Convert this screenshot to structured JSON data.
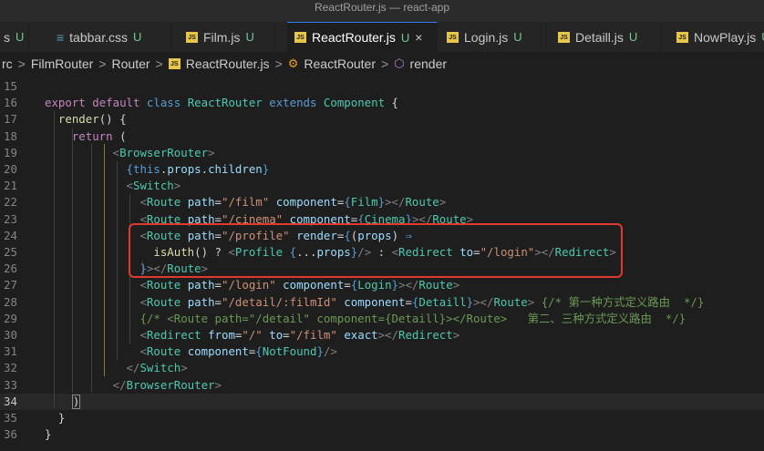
{
  "window": {
    "title": "ReactRouter.js — react-app"
  },
  "tabs": [
    {
      "name": "s",
      "status": "U",
      "icon": "js-file-icon"
    },
    {
      "name": "tabbar.css",
      "status": "U",
      "icon": "css-file-icon"
    },
    {
      "name": "Film.js",
      "status": "U",
      "icon": "js-file-icon"
    },
    {
      "name": "ReactRouter.js",
      "status": "U",
      "icon": "js-file-icon",
      "active": true,
      "close": "×"
    },
    {
      "name": "Login.js",
      "status": "U",
      "icon": "js-file-icon"
    },
    {
      "name": "Detaill.js",
      "status": "U",
      "icon": "js-file-icon"
    },
    {
      "name": "NowPlay.js",
      "status": "U",
      "icon": "js-file-icon"
    }
  ],
  "breadcrumb": {
    "items": [
      "rc",
      "FilmRouter",
      "Router",
      "ReactRouter.js",
      "ReactRouter",
      "render"
    ],
    "separator": ">"
  },
  "editor": {
    "current_line": "34",
    "lines": [
      {
        "num": "15",
        "html": ""
      },
      {
        "num": "16",
        "html": "<span class='kw2'>export</span> <span class='kw2'>default</span> <span class='kw'>class</span> <span class='cls'>ReactRouter</span> <span class='kw'>extends</span> <span class='cls'>Component</span> <span class='plain'>{</span>"
      },
      {
        "num": "17",
        "html": "  <span class='fn'>render</span><span class='plain'>() {</span>"
      },
      {
        "num": "18",
        "html": "    <span class='kw2'>return</span> <span class='plain'>(</span>"
      },
      {
        "num": "19",
        "html": "          <span class='pun'>&lt;</span><span class='tag'>BrowserRouter</span><span class='pun'>&gt;</span>"
      },
      {
        "num": "20",
        "html": "            <span class='kw'>{</span><span class='kw'>this</span><span class='plain'>.</span><span class='var'>props</span><span class='plain'>.</span><span class='var'>children</span><span class='kw'>}</span>"
      },
      {
        "num": "21",
        "html": "            <span class='pun'>&lt;</span><span class='tag'>Switch</span><span class='pun'>&gt;</span>"
      },
      {
        "num": "22",
        "html": "              <span class='pun'>&lt;</span><span class='tag'>Route</span> <span class='attr'>path</span><span class='plain'>=</span><span class='str'>\"/film\"</span> <span class='attr'>component</span><span class='plain'>=</span><span class='kw'>{</span><span class='cls'>Film</span><span class='kw'>}</span><span class='pun'>&gt;&lt;/</span><span class='tag'>Route</span><span class='pun'>&gt;</span>"
      },
      {
        "num": "23",
        "html": "              <span class='pun'>&lt;</span><span class='tag'>Route</span> <span class='attr'>path</span><span class='plain'>=</span><span class='str'>\"/cinema\"</span> <span class='attr'>component</span><span class='plain'>=</span><span class='kw'>{</span><span class='cls'>Cinema</span><span class='kw'>}</span><span class='pun'>&gt;&lt;/</span><span class='tag'>Route</span><span class='pun'>&gt;</span>"
      },
      {
        "num": "24",
        "html": "              <span class='pun'>&lt;</span><span class='tag'>Route</span> <span class='attr'>path</span><span class='plain'>=</span><span class='str'>\"/profile\"</span> <span class='attr'>render</span><span class='plain'>=</span><span class='kw'>{</span><span class='plain'>(</span><span class='var'>props</span><span class='plain'>)</span> <span class='kw'>⇒</span>"
      },
      {
        "num": "25",
        "html": "                <span class='fn'>isAuth</span><span class='plain'>() ? </span><span class='pun'>&lt;</span><span class='tag'>Profile</span> <span class='kw'>{</span><span class='plain'>...</span><span class='var'>props</span><span class='kw'>}</span><span class='pun'>/&gt;</span> <span class='plain'>:</span> <span class='pun'>&lt;</span><span class='tag'>Redirect</span> <span class='attr'>to</span><span class='plain'>=</span><span class='str'>\"/login\"</span><span class='pun'>&gt;&lt;/</span><span class='tag'>Redirect</span><span class='pun'>&gt;</span>"
      },
      {
        "num": "26",
        "html": "              <span class='kw'>}</span><span class='pun'>&gt;&lt;/</span><span class='tag'>Route</span><span class='pun'>&gt;</span>"
      },
      {
        "num": "27",
        "html": "              <span class='pun'>&lt;</span><span class='tag'>Route</span> <span class='attr'>path</span><span class='plain'>=</span><span class='str'>\"/login\"</span> <span class='attr'>component</span><span class='plain'>=</span><span class='kw'>{</span><span class='cls'>Login</span><span class='kw'>}</span><span class='pun'>&gt;&lt;/</span><span class='tag'>Route</span><span class='pun'>&gt;</span>"
      },
      {
        "num": "28",
        "html": "              <span class='pun'>&lt;</span><span class='tag'>Route</span> <span class='attr'>path</span><span class='plain'>=</span><span class='str'>\"/detail/:filmId\"</span> <span class='attr'>component</span><span class='plain'>=</span><span class='kw'>{</span><span class='cls'>Detaill</span><span class='kw'>}</span><span class='pun'>&gt;&lt;/</span><span class='tag'>Route</span><span class='pun'>&gt;</span> <span class='cmt'>{/* 第一种方式定义路由  */}</span>"
      },
      {
        "num": "29",
        "html": "              <span class='cmt'>{/* &lt;Route path=\"/detail\" component={Detaill}&gt;&lt;/Route&gt;   第二、三种方式定义路由  */}</span>"
      },
      {
        "num": "30",
        "html": "              <span class='pun'>&lt;</span><span class='tag'>Redirect</span> <span class='attr'>from</span><span class='plain'>=</span><span class='str'>\"/\"</span> <span class='attr'>to</span><span class='plain'>=</span><span class='str'>\"/film\"</span> <span class='attr'>exact</span><span class='pun'>&gt;&lt;/</span><span class='tag'>Redirect</span><span class='pun'>&gt;</span>"
      },
      {
        "num": "31",
        "html": "              <span class='pun'>&lt;</span><span class='tag'>Route</span> <span class='attr'>component</span><span class='plain'>=</span><span class='kw'>{</span><span class='cls'>NotFound</span><span class='kw'>}</span><span class='pun'>/&gt;</span>"
      },
      {
        "num": "32",
        "html": "            <span class='pun'>&lt;/</span><span class='tag'>Switch</span><span class='pun'>&gt;</span>"
      },
      {
        "num": "33",
        "html": "          <span class='pun'>&lt;/</span><span class='tag'>BrowserRouter</span><span class='pun'>&gt;</span>"
      },
      {
        "num": "34",
        "html": "    <span class='cursor-box plain'>)</span>"
      },
      {
        "num": "35",
        "html": "  <span class='plain'>}</span>"
      },
      {
        "num": "36",
        "html": "<span class='plain'>}</span>"
      }
    ]
  }
}
